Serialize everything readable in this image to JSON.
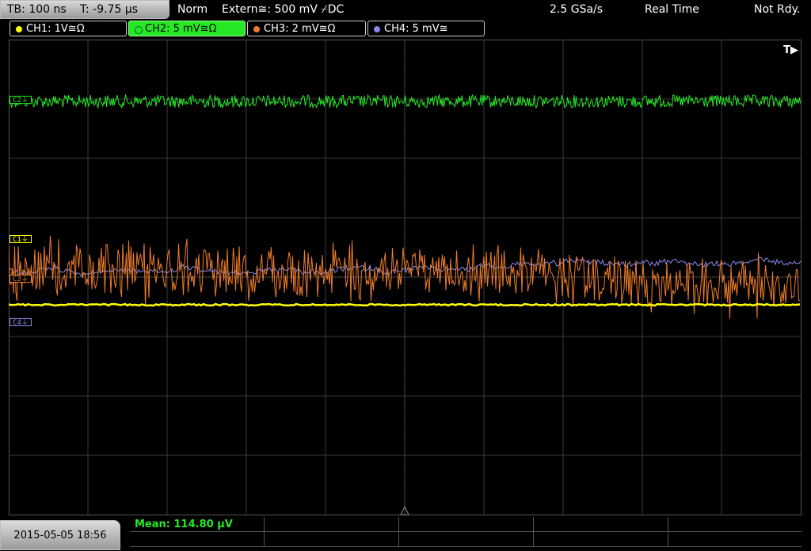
{
  "status": {
    "timebase": "TB: 100 ns",
    "trigger_time": "T: -9.75 µs",
    "mode": "Norm",
    "trigger_source": "Extern≅: 500 mV ⌿DC",
    "sample_rate": "2.5 GSa/s",
    "acq_mode": "Real Time",
    "state": "Not Rdy."
  },
  "channels": [
    {
      "label": "CH1: 1V≅Ω",
      "color": "#ffff00",
      "active": false
    },
    {
      "label": "CH2: 5 mV≅Ω",
      "color": "#27e827",
      "active": true
    },
    {
      "label": "CH3: 2 mV≅Ω",
      "color": "#f07d28",
      "active": false
    },
    {
      "label": "CH4: 5 mV≅",
      "color": "#8888ee",
      "active": false
    }
  ],
  "markers": {
    "c1": "C1⏚",
    "c2": "C2⏚",
    "c3": "C3⏚",
    "c4": "C4⏚",
    "trigger": "T▶"
  },
  "footer": {
    "datetime": "2015-05-05 18:56",
    "mean": "Mean: 114.80 µV"
  },
  "colors": {
    "ch1": "#ffff00",
    "ch2": "#27e827",
    "ch3": "#f07d28",
    "ch4": "#8888ee",
    "grid": "#3a3a3a"
  }
}
